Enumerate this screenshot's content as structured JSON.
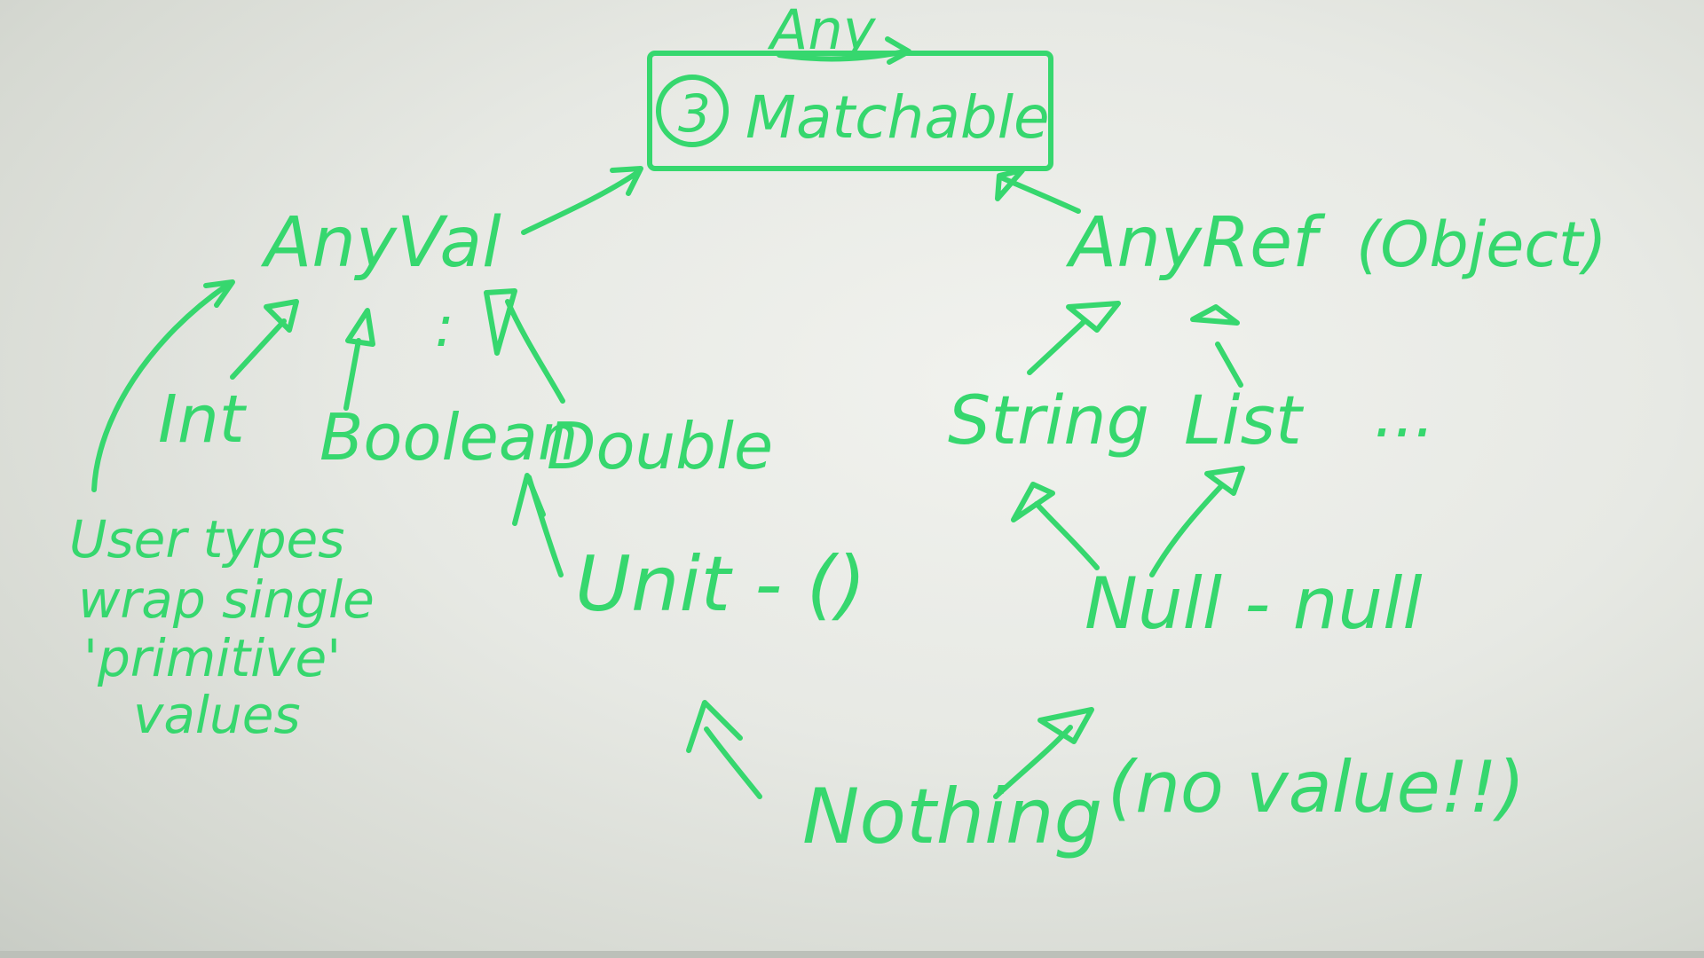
{
  "diagram": {
    "nodes": {
      "any": "Any",
      "matchable_number": "3",
      "matchable": "Matchable",
      "anyval": "AnyVal",
      "anyref": "AnyRef",
      "object_note": "(Object)",
      "int": "Int",
      "boolean": "Boolean",
      "double": "Double",
      "ellipsis_vertical": ":",
      "string": "String",
      "list": "List",
      "ellipsis": "...",
      "unit": "Unit - ()",
      "null": "Null - null",
      "nothing": "Nothing",
      "no_value_note": "(no value!!)"
    },
    "user_note": [
      "User types",
      "wrap single",
      "'primitive'",
      "values"
    ]
  },
  "colors": {
    "ink": "#36d76e",
    "board": "#e7e9e4"
  }
}
